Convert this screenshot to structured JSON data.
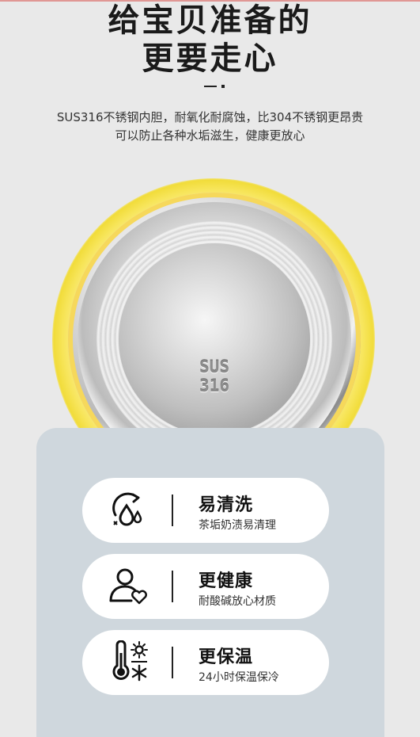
{
  "headline": {
    "line1": "给宝贝准备的",
    "line2": "更要走心"
  },
  "subtitle": {
    "line1": "SUS316不锈钢内胆，耐氧化耐腐蚀，比304不锈钢更昂贵",
    "line2": "可以防止各种水垢滋生，健康更放心"
  },
  "cup": {
    "engraving_line1": "SUS",
    "engraving_line2": "316",
    "accent_color": "#f1dc3a"
  },
  "features": [
    {
      "icon": "water-drop-cycle-icon",
      "title": "易清洗",
      "desc": "茶垢奶渍易清理"
    },
    {
      "icon": "person-heart-icon",
      "title": "更健康",
      "desc": "耐酸碱放心材质"
    },
    {
      "icon": "thermometer-sun-snow-icon",
      "title": "更保温",
      "desc": "24小时保温保冷"
    }
  ],
  "colors": {
    "panel": "#cfd7dd",
    "card": "#ffffff",
    "text": "#111111"
  }
}
